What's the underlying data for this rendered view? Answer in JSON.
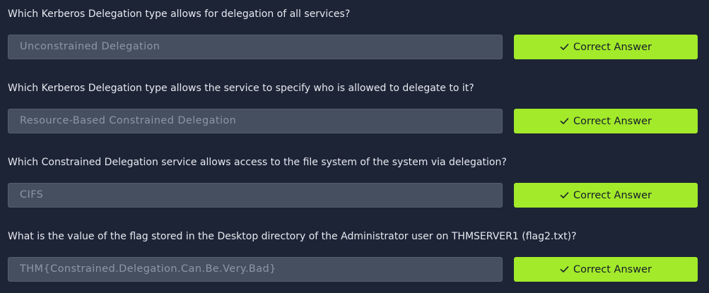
{
  "questions": [
    {
      "text": "Which Kerberos Delegation type allows for delegation of all services?",
      "answer": "Unconstrained Delegation",
      "button_label": "Correct Answer"
    },
    {
      "text": "Which Kerberos Delegation type allows the service to specify who is allowed to delegate to it?",
      "answer": "Resource-Based Constrained Delegation",
      "button_label": "Correct Answer"
    },
    {
      "text": "Which Constrained Delegation service allows access to the file system of the system via delegation?",
      "answer": "CIFS",
      "button_label": "Correct Answer"
    },
    {
      "text": "What is the value of the flag stored in the Desktop directory of the Administrator user on THMSERVER1 (flag2.txt)?",
      "answer": "THM{Constrained.Delegation.Can.Be.Very.Bad}",
      "button_label": "Correct Answer"
    }
  ],
  "colors": {
    "background": "#1d2436",
    "input_background": "#454f5f",
    "button_accent": "#a3ea2a"
  },
  "icons": {
    "button_icon": "check-icon"
  }
}
